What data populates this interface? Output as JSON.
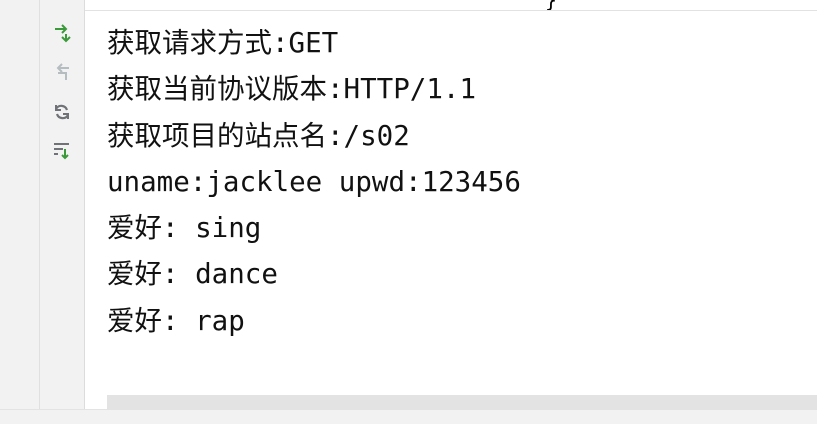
{
  "console": {
    "top_fragment": "}",
    "lines": [
      "获取请求方式:GET",
      "获取当前协议版本:HTTP/1.1",
      "获取项目的站点名:/s02",
      "uname:jacklee upwd:123456",
      "爱好: sing",
      "爱好: dance",
      "爱好: rap"
    ]
  },
  "toolbar": {
    "icons": [
      "step-over-icon",
      "step-back-icon",
      "rerun-icon",
      "soft-wrap-icon"
    ]
  },
  "colors": {
    "accent_green": "#3a9a3a",
    "disabled_gray": "#9aa4a8",
    "icon_gray": "#6f7377"
  }
}
